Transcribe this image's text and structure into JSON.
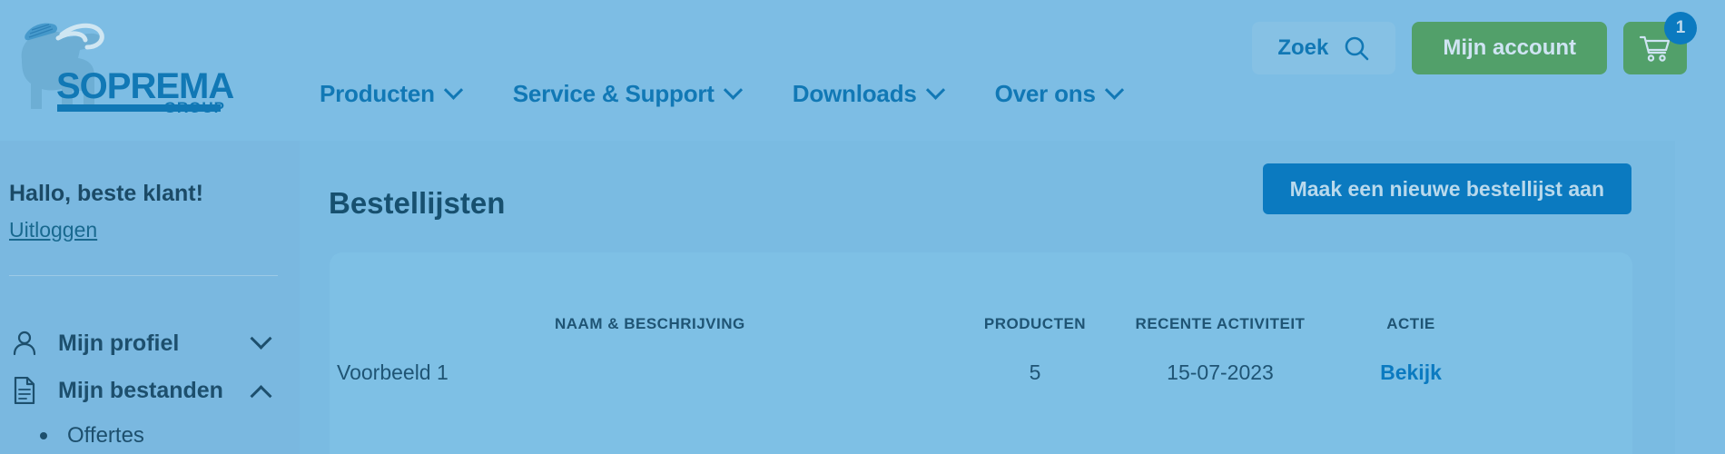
{
  "brand": {
    "name": "SOPREMA",
    "suffix": "GROUP",
    "logo_icon": "mammoth-logo"
  },
  "header": {
    "nav": [
      {
        "label": "Producten",
        "icon": "chevron-down-icon"
      },
      {
        "label": "Service & Support",
        "icon": "chevron-down-icon"
      },
      {
        "label": "Downloads",
        "icon": "chevron-down-icon"
      },
      {
        "label": "Over ons",
        "icon": "chevron-down-icon"
      }
    ],
    "search_label": "Zoek",
    "search_icon": "search-icon",
    "account_label": "Mijn account",
    "cart_icon": "shopping-cart-icon",
    "cart_count": "1"
  },
  "sidebar": {
    "greeting": "Hallo, beste klant!",
    "logout_label": "Uitloggen",
    "menu": [
      {
        "label": "Mijn profiel",
        "icon": "user-icon",
        "state": "collapsed"
      },
      {
        "label": "Mijn bestanden",
        "icon": "document-icon",
        "state": "expanded"
      }
    ],
    "submenu": [
      {
        "label": "Offertes"
      }
    ]
  },
  "main": {
    "page_title": "Bestellijsten",
    "new_list_button": "Maak een nieuwe bestellijst aan",
    "table": {
      "columns": [
        "NAAM & BESCHRIJVING",
        "PRODUCTEN",
        "RECENTE ACTIVITEIT",
        "ACTIE"
      ],
      "rows": [
        {
          "name": "Voorbeeld 1",
          "products": "5",
          "activity": "15-07-2023",
          "action": "Bekijk"
        }
      ]
    }
  },
  "colors": {
    "page_bg": "#74b3dc",
    "header_bg": "#7dbde4",
    "sidebar_bg": "#7ab8e0",
    "main_bg": "#7abbe2",
    "card_bg": "#7ec0e5",
    "brand_blue": "#1178b5",
    "accent_blue": "#0b7ac0",
    "accent_green": "#52a06a",
    "text_dark": "#1f5474"
  }
}
